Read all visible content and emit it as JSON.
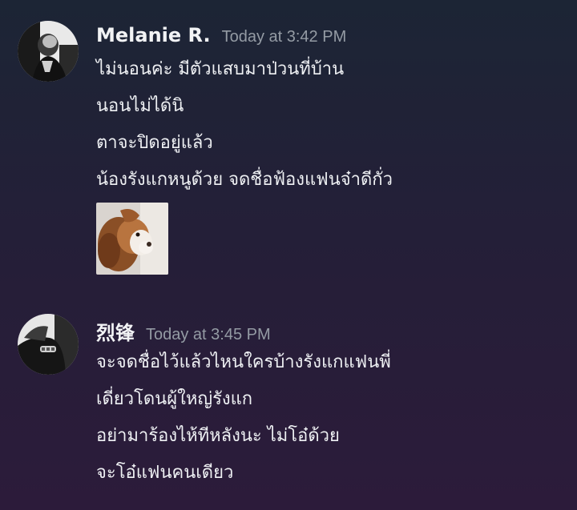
{
  "messages": [
    {
      "username": "Melanie R.",
      "timestamp": "Today at 3:42 PM",
      "lines": [
        "ไม่นอนค่ะ มีตัวแสบมาป่วนที่บ้าน",
        "นอนไม่ได้นิ",
        "ตาจะปิดอยู่แล้ว",
        "น้องรังแกหนูด้วย จดชื่อฟ้องแฟนจ๋าดีกั่ว"
      ],
      "attachment": "dog-photo"
    },
    {
      "username": "烈锋",
      "timestamp": "Today at 3:45 PM",
      "lines": [
        "จะจดชื่อไว้แล้วไหนใครบ้างรังแกแฟนพี่",
        "เดี่ยวโดนผู้ใหญ่รังแก",
        "อย่ามาร้องไห้ทีหลังนะ ไม่โอ๋ด้วย",
        "จะโอ๋แฟนคนเดียว"
      ]
    }
  ],
  "colors": {
    "username": "#f2f3f5",
    "timestamp": "#949ba4",
    "text": "#eef0f3",
    "background_top": "#1c2535",
    "background_bottom": "#2c1b3a"
  },
  "icons": {
    "avatar_1": "user-avatar-icon",
    "avatar_2": "user-avatar-icon"
  }
}
